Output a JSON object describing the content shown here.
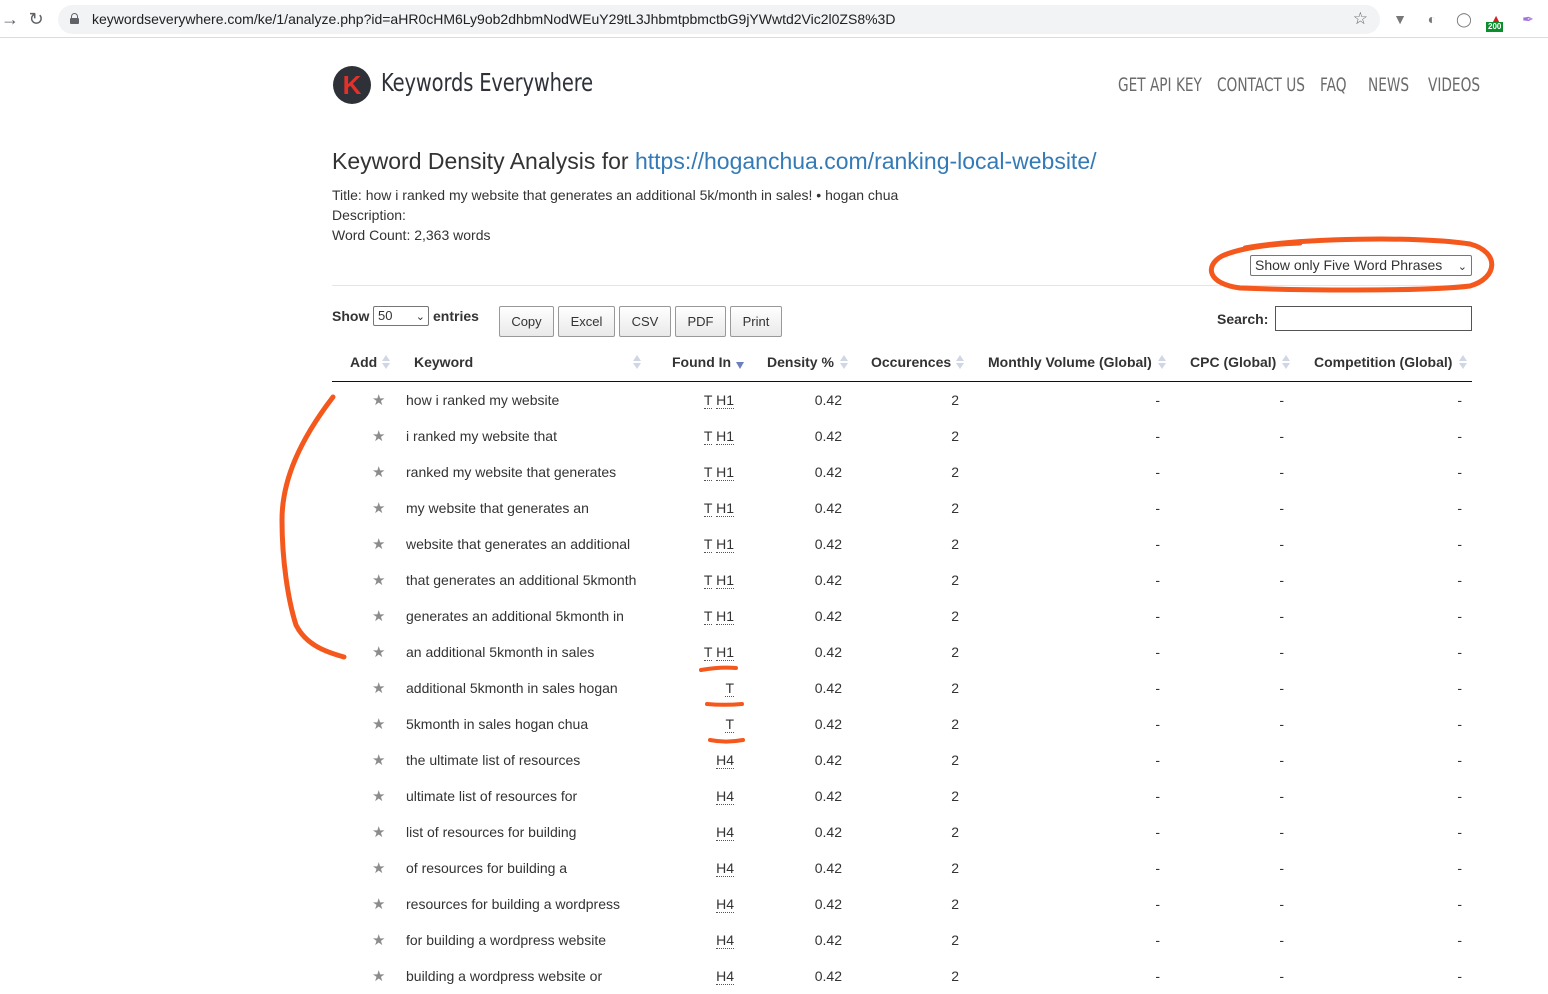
{
  "browser": {
    "url": "keywordseverywhere.com/ke/1/analyze.php?id=aHR0cHM6Ly9ob2dhbmNodWEuY29tL3JhbmtpbmctbG9jYWwtd2Vic2l0ZS8%3D",
    "back_icon": "arrow-right-icon",
    "reload_icon": "reload-icon",
    "extension_badge": "200"
  },
  "site": {
    "logo_letter": "K",
    "logo_text": "Keywords Everywhere",
    "nav": [
      "GET API KEY",
      "CONTACT US",
      "FAQ",
      "NEWS",
      "VIDEOS"
    ]
  },
  "analysis": {
    "heading_prefix": "Keyword Density Analysis for",
    "heading_url": "https://hoganchua.com/ranking-local-website/",
    "title_line": "Title: how i ranked my website that generates an additional 5k/month in sales! • hogan chua",
    "description_line": "Description:",
    "word_count_line": "Word Count: 2,363 words",
    "phrase_filter": "Show only Five Word Phrases"
  },
  "controls": {
    "show_label": "Show",
    "entries_value": "50",
    "entries_label": "entries",
    "buttons": [
      "Copy",
      "Excel",
      "CSV",
      "PDF",
      "Print"
    ],
    "search_label": "Search:",
    "search_value": ""
  },
  "table": {
    "columns": [
      "Add",
      "Keyword",
      "Found In",
      "Density %",
      "Occurences",
      "Monthly Volume (Global)",
      "CPC (Global)",
      "Competition (Global)"
    ],
    "rows": [
      {
        "keyword": "how i ranked my website",
        "found": [
          "T",
          "H1"
        ],
        "density": "0.42",
        "occ": "2",
        "vol": "-",
        "cpc": "-",
        "comp": "-"
      },
      {
        "keyword": "i ranked my website that",
        "found": [
          "T",
          "H1"
        ],
        "density": "0.42",
        "occ": "2",
        "vol": "-",
        "cpc": "-",
        "comp": "-"
      },
      {
        "keyword": "ranked my website that generates",
        "found": [
          "T",
          "H1"
        ],
        "density": "0.42",
        "occ": "2",
        "vol": "-",
        "cpc": "-",
        "comp": "-"
      },
      {
        "keyword": "my website that generates an",
        "found": [
          "T",
          "H1"
        ],
        "density": "0.42",
        "occ": "2",
        "vol": "-",
        "cpc": "-",
        "comp": "-"
      },
      {
        "keyword": "website that generates an additional",
        "found": [
          "T",
          "H1"
        ],
        "density": "0.42",
        "occ": "2",
        "vol": "-",
        "cpc": "-",
        "comp": "-"
      },
      {
        "keyword": "that generates an additional 5kmonth",
        "found": [
          "T",
          "H1"
        ],
        "density": "0.42",
        "occ": "2",
        "vol": "-",
        "cpc": "-",
        "comp": "-"
      },
      {
        "keyword": "generates an additional 5kmonth in",
        "found": [
          "T",
          "H1"
        ],
        "density": "0.42",
        "occ": "2",
        "vol": "-",
        "cpc": "-",
        "comp": "-"
      },
      {
        "keyword": "an additional 5kmonth in sales",
        "found": [
          "T",
          "H1"
        ],
        "density": "0.42",
        "occ": "2",
        "vol": "-",
        "cpc": "-",
        "comp": "-"
      },
      {
        "keyword": "additional 5kmonth in sales hogan",
        "found": [
          "T"
        ],
        "density": "0.42",
        "occ": "2",
        "vol": "-",
        "cpc": "-",
        "comp": "-"
      },
      {
        "keyword": "5kmonth in sales hogan chua",
        "found": [
          "T"
        ],
        "density": "0.42",
        "occ": "2",
        "vol": "-",
        "cpc": "-",
        "comp": "-"
      },
      {
        "keyword": "the ultimate list of resources",
        "found": [
          "H4"
        ],
        "density": "0.42",
        "occ": "2",
        "vol": "-",
        "cpc": "-",
        "comp": "-"
      },
      {
        "keyword": "ultimate list of resources for",
        "found": [
          "H4"
        ],
        "density": "0.42",
        "occ": "2",
        "vol": "-",
        "cpc": "-",
        "comp": "-"
      },
      {
        "keyword": "list of resources for building",
        "found": [
          "H4"
        ],
        "density": "0.42",
        "occ": "2",
        "vol": "-",
        "cpc": "-",
        "comp": "-"
      },
      {
        "keyword": "of resources for building a",
        "found": [
          "H4"
        ],
        "density": "0.42",
        "occ": "2",
        "vol": "-",
        "cpc": "-",
        "comp": "-"
      },
      {
        "keyword": "resources for building a wordpress",
        "found": [
          "H4"
        ],
        "density": "0.42",
        "occ": "2",
        "vol": "-",
        "cpc": "-",
        "comp": "-"
      },
      {
        "keyword": "for building a wordpress website",
        "found": [
          "H4"
        ],
        "density": "0.42",
        "occ": "2",
        "vol": "-",
        "cpc": "-",
        "comp": "-"
      },
      {
        "keyword": "building a wordpress website or",
        "found": [
          "H4"
        ],
        "density": "0.42",
        "occ": "2",
        "vol": "-",
        "cpc": "-",
        "comp": "-"
      }
    ]
  },
  "colors": {
    "link": "#337ab7",
    "annotation": "#f4581c",
    "logo_red": "#e0312a"
  }
}
